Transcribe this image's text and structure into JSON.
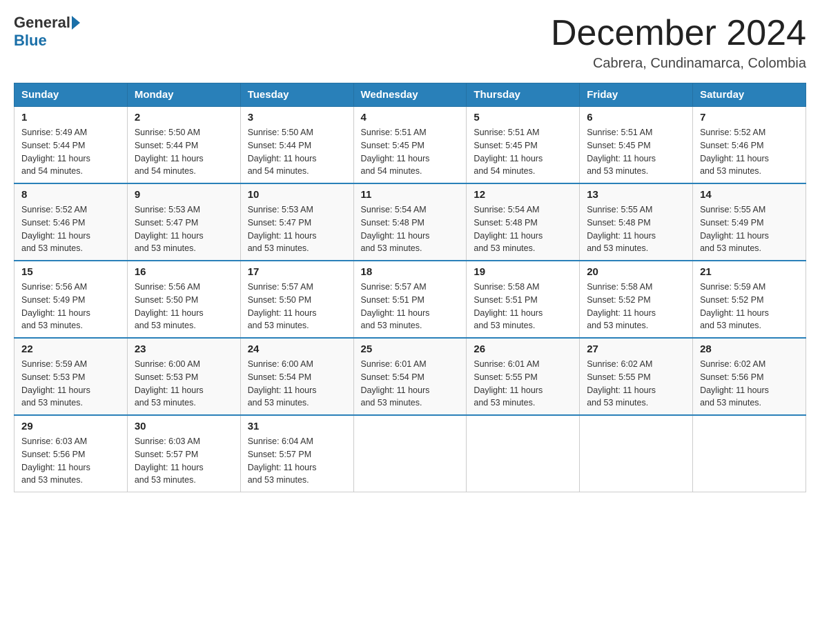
{
  "header": {
    "logo_general": "General",
    "logo_blue": "Blue",
    "month_title": "December 2024",
    "location": "Cabrera, Cundinamarca, Colombia"
  },
  "weekdays": [
    "Sunday",
    "Monday",
    "Tuesday",
    "Wednesday",
    "Thursday",
    "Friday",
    "Saturday"
  ],
  "weeks": [
    [
      {
        "day": "1",
        "sunrise": "5:49 AM",
        "sunset": "5:44 PM",
        "daylight": "11 hours and 54 minutes."
      },
      {
        "day": "2",
        "sunrise": "5:50 AM",
        "sunset": "5:44 PM",
        "daylight": "11 hours and 54 minutes."
      },
      {
        "day": "3",
        "sunrise": "5:50 AM",
        "sunset": "5:44 PM",
        "daylight": "11 hours and 54 minutes."
      },
      {
        "day": "4",
        "sunrise": "5:51 AM",
        "sunset": "5:45 PM",
        "daylight": "11 hours and 54 minutes."
      },
      {
        "day": "5",
        "sunrise": "5:51 AM",
        "sunset": "5:45 PM",
        "daylight": "11 hours and 54 minutes."
      },
      {
        "day": "6",
        "sunrise": "5:51 AM",
        "sunset": "5:45 PM",
        "daylight": "11 hours and 53 minutes."
      },
      {
        "day": "7",
        "sunrise": "5:52 AM",
        "sunset": "5:46 PM",
        "daylight": "11 hours and 53 minutes."
      }
    ],
    [
      {
        "day": "8",
        "sunrise": "5:52 AM",
        "sunset": "5:46 PM",
        "daylight": "11 hours and 53 minutes."
      },
      {
        "day": "9",
        "sunrise": "5:53 AM",
        "sunset": "5:47 PM",
        "daylight": "11 hours and 53 minutes."
      },
      {
        "day": "10",
        "sunrise": "5:53 AM",
        "sunset": "5:47 PM",
        "daylight": "11 hours and 53 minutes."
      },
      {
        "day": "11",
        "sunrise": "5:54 AM",
        "sunset": "5:48 PM",
        "daylight": "11 hours and 53 minutes."
      },
      {
        "day": "12",
        "sunrise": "5:54 AM",
        "sunset": "5:48 PM",
        "daylight": "11 hours and 53 minutes."
      },
      {
        "day": "13",
        "sunrise": "5:55 AM",
        "sunset": "5:48 PM",
        "daylight": "11 hours and 53 minutes."
      },
      {
        "day": "14",
        "sunrise": "5:55 AM",
        "sunset": "5:49 PM",
        "daylight": "11 hours and 53 minutes."
      }
    ],
    [
      {
        "day": "15",
        "sunrise": "5:56 AM",
        "sunset": "5:49 PM",
        "daylight": "11 hours and 53 minutes."
      },
      {
        "day": "16",
        "sunrise": "5:56 AM",
        "sunset": "5:50 PM",
        "daylight": "11 hours and 53 minutes."
      },
      {
        "day": "17",
        "sunrise": "5:57 AM",
        "sunset": "5:50 PM",
        "daylight": "11 hours and 53 minutes."
      },
      {
        "day": "18",
        "sunrise": "5:57 AM",
        "sunset": "5:51 PM",
        "daylight": "11 hours and 53 minutes."
      },
      {
        "day": "19",
        "sunrise": "5:58 AM",
        "sunset": "5:51 PM",
        "daylight": "11 hours and 53 minutes."
      },
      {
        "day": "20",
        "sunrise": "5:58 AM",
        "sunset": "5:52 PM",
        "daylight": "11 hours and 53 minutes."
      },
      {
        "day": "21",
        "sunrise": "5:59 AM",
        "sunset": "5:52 PM",
        "daylight": "11 hours and 53 minutes."
      }
    ],
    [
      {
        "day": "22",
        "sunrise": "5:59 AM",
        "sunset": "5:53 PM",
        "daylight": "11 hours and 53 minutes."
      },
      {
        "day": "23",
        "sunrise": "6:00 AM",
        "sunset": "5:53 PM",
        "daylight": "11 hours and 53 minutes."
      },
      {
        "day": "24",
        "sunrise": "6:00 AM",
        "sunset": "5:54 PM",
        "daylight": "11 hours and 53 minutes."
      },
      {
        "day": "25",
        "sunrise": "6:01 AM",
        "sunset": "5:54 PM",
        "daylight": "11 hours and 53 minutes."
      },
      {
        "day": "26",
        "sunrise": "6:01 AM",
        "sunset": "5:55 PM",
        "daylight": "11 hours and 53 minutes."
      },
      {
        "day": "27",
        "sunrise": "6:02 AM",
        "sunset": "5:55 PM",
        "daylight": "11 hours and 53 minutes."
      },
      {
        "day": "28",
        "sunrise": "6:02 AM",
        "sunset": "5:56 PM",
        "daylight": "11 hours and 53 minutes."
      }
    ],
    [
      {
        "day": "29",
        "sunrise": "6:03 AM",
        "sunset": "5:56 PM",
        "daylight": "11 hours and 53 minutes."
      },
      {
        "day": "30",
        "sunrise": "6:03 AM",
        "sunset": "5:57 PM",
        "daylight": "11 hours and 53 minutes."
      },
      {
        "day": "31",
        "sunrise": "6:04 AM",
        "sunset": "5:57 PM",
        "daylight": "11 hours and 53 minutes."
      },
      {
        "day": "",
        "sunrise": "",
        "sunset": "",
        "daylight": ""
      },
      {
        "day": "",
        "sunrise": "",
        "sunset": "",
        "daylight": ""
      },
      {
        "day": "",
        "sunrise": "",
        "sunset": "",
        "daylight": ""
      },
      {
        "day": "",
        "sunrise": "",
        "sunset": "",
        "daylight": ""
      }
    ]
  ]
}
